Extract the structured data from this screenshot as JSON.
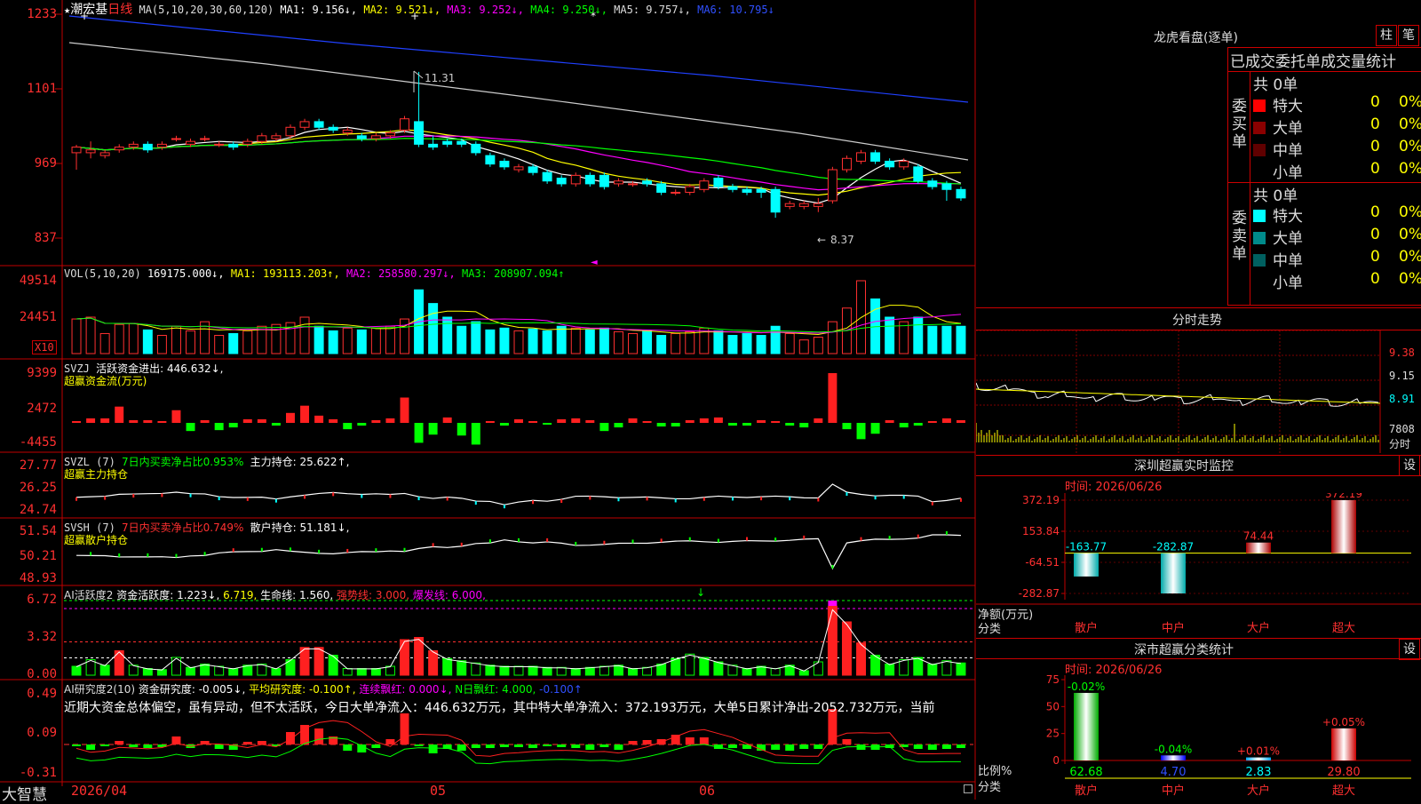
{
  "stock": {
    "name": "潮宏基",
    "period": "日线",
    "ma_header": {
      "label": "MA(5,10,20,30,60,120)",
      "ma1": "MA1: 9.156↓,",
      "ma2": "MA2: 9.521↓,",
      "ma3": "MA3: 9.252↓,",
      "ma4": "MA4: 9.250↓,",
      "ma5": "MA5: 9.757↓,",
      "ma6": "MA6: 10.795↓"
    },
    "price_axis": [
      "1233",
      "1101",
      "969",
      "837"
    ],
    "high_label": "11.31",
    "low_label": "8.37"
  },
  "vol_panel": {
    "label": "VOL(5,10,20)",
    "value": "169175.000↓,",
    "ma1": "MA1: 193113.203↑,",
    "ma2": "MA2: 258580.297↓,",
    "ma3": "MA3: 208907.094↑",
    "axis": [
      "49514",
      "24451"
    ],
    "unit": "X10"
  },
  "svzj_panel": {
    "label": "SVZJ",
    "line1": "活跃资金进出: 446.632↓,",
    "line2": "超赢资金流(万元)",
    "axis": [
      "9399",
      "2472",
      "-4455"
    ]
  },
  "svzl_panel": {
    "label": "SVZL (7)",
    "ratio": "7日内买卖净占比0.953%",
    "hold": "主力持仓: 25.622↑,",
    "line2": "超赢主力持仓",
    "axis": [
      "27.77",
      "26.25",
      "24.74"
    ]
  },
  "svsh_panel": {
    "label": "SVSH (7)",
    "ratio": "7日内买卖净占比0.749%",
    "hold": "散户持仓: 51.181↓,",
    "line2": "超赢散户持仓",
    "axis": [
      "51.54",
      "50.21",
      "48.93"
    ]
  },
  "ai_active_panel": {
    "label": "AI活跃度2",
    "degree": "资金活跃度: 1.223↓,",
    "v2": "6.719,",
    "life": "生命线: 1.560,",
    "strong": "强势线: 3.000,",
    "burst": "爆发线: 6.000,",
    "axis": [
      "6.72",
      "3.32",
      "0.00"
    ]
  },
  "ai_research_panel": {
    "label": "AI研究度2(10)",
    "research": "资金研究度: -0.005↓,",
    "avg": "平均研究度: -0.100↑,",
    "red": "连续飘红: 0.000↓,",
    "nred": "N日飘红: 4.000,",
    "nred2": "-0.100↑",
    "comment": "近期大资金总体偏空，虽有异动，但不太活跃，今日大单净流入：446.632万元，其中特大单净流入：372.193万元，大单5日累计净出-2052.732万元，当前",
    "axis": [
      "0.49",
      "0.09",
      "-0.31"
    ]
  },
  "bottom_bar": {
    "brand": "大智慧",
    "date": "2026/04",
    "month1": "05",
    "month2": "06"
  },
  "longhu": {
    "title": "龙虎看盘(逐单)",
    "btn_zhu": "柱",
    "btn_bi": "笔",
    "subtitle": "已成交委托单成交量统计",
    "buy_label": "委买单",
    "sell_label": "委卖单",
    "buy_total": "共 0单",
    "sell_total": "共 0单",
    "buy_rows": [
      {
        "name": "特大",
        "count": "0",
        "pct": "0%",
        "color": "#ff0000"
      },
      {
        "name": "大单",
        "count": "0",
        "pct": "0%",
        "color": "#8b0000"
      },
      {
        "name": "中单",
        "count": "0",
        "pct": "0%",
        "color": "#600000"
      },
      {
        "name": "小单",
        "count": "0",
        "pct": "0%",
        "color": "#000000"
      }
    ],
    "sell_rows": [
      {
        "name": "特大",
        "count": "0",
        "pct": "0%",
        "color": "#00ffff"
      },
      {
        "name": "大单",
        "count": "0",
        "pct": "0%",
        "color": "#008b8b"
      },
      {
        "name": "中单",
        "count": "0",
        "pct": "0%",
        "color": "#006060"
      },
      {
        "name": "小单",
        "count": "0",
        "pct": "0%",
        "color": "#000000"
      }
    ]
  },
  "intraday": {
    "title": "分时走势",
    "axis": [
      "9.38",
      "9.15",
      "8.91",
      "7808"
    ],
    "label": "分时"
  },
  "monitor": {
    "title": "深圳超赢实时监控",
    "btn": "设",
    "time": "时间: 2026/06/26",
    "axis": [
      "372.19",
      "153.84",
      "-64.51",
      "-282.87"
    ],
    "row_label1": "净额(万元)",
    "row_label2": "分类",
    "categories": [
      "散户",
      "中户",
      "大户",
      "超大"
    ],
    "values": [
      -163.77,
      -282.87,
      74.44,
      372.19
    ],
    "value_labels": [
      "-163.77",
      "-282.87",
      "74.44",
      "372.19"
    ]
  },
  "classify": {
    "title": "深市超赢分类统计",
    "btn": "设",
    "time": "时间: 2026/06/26",
    "axis": [
      "75",
      "50",
      "25",
      "0"
    ],
    "row_label1": "比例%",
    "row_label2": "分类",
    "categories": [
      "散户",
      "中户",
      "大户",
      "超大"
    ],
    "changes": [
      "-0.02%",
      "-0.04%",
      "+0.01%",
      "+0.05%"
    ],
    "values": [
      62.68,
      4.7,
      2.83,
      29.8
    ],
    "value_labels": [
      "62.68",
      "4.70",
      "2.83",
      "29.80"
    ]
  },
  "chart_data": {
    "type": "candlestick",
    "candles": [
      [
        9.88,
        9.98,
        9.58,
        10.02
      ],
      [
        9.88,
        9.93,
        9.78,
        10.08
      ],
      [
        9.83,
        9.88,
        9.78,
        9.93
      ],
      [
        9.93,
        9.98,
        9.88,
        10.03
      ],
      [
        9.98,
        10.03,
        9.93,
        10.08
      ],
      [
        10.03,
        9.93,
        9.88,
        10.08
      ],
      [
        9.98,
        10.03,
        9.93,
        10.08
      ],
      [
        10.13,
        10.13,
        10.08,
        10.18
      ],
      [
        10.03,
        10.08,
        9.98,
        10.13
      ],
      [
        10.13,
        10.13,
        10.08,
        10.18
      ],
      [
        10.03,
        10.03,
        9.98,
        10.08
      ],
      [
        10.03,
        9.98,
        9.93,
        10.08
      ],
      [
        10.03,
        10.08,
        9.98,
        10.13
      ],
      [
        10.08,
        10.18,
        10.03,
        10.23
      ],
      [
        10.13,
        10.18,
        10.08,
        10.23
      ],
      [
        10.18,
        10.33,
        10.13,
        10.38
      ],
      [
        10.33,
        10.43,
        10.28,
        10.48
      ],
      [
        10.43,
        10.33,
        10.28,
        10.48
      ],
      [
        10.33,
        10.28,
        10.23,
        10.38
      ],
      [
        10.23,
        10.28,
        10.18,
        10.33
      ],
      [
        10.18,
        10.13,
        10.08,
        10.23
      ],
      [
        10.13,
        10.18,
        10.08,
        10.23
      ],
      [
        10.18,
        10.23,
        10.13,
        10.28
      ],
      [
        10.28,
        10.48,
        10.23,
        10.53
      ],
      [
        10.43,
        10.03,
        9.98,
        11.31
      ],
      [
        10.03,
        9.98,
        9.93,
        10.18
      ],
      [
        10.08,
        10.03,
        9.98,
        10.13
      ],
      [
        10.08,
        10.03,
        9.98,
        10.13
      ],
      [
        10.03,
        9.88,
        9.83,
        10.08
      ],
      [
        9.83,
        9.68,
        9.63,
        9.88
      ],
      [
        9.73,
        9.63,
        9.58,
        9.78
      ],
      [
        9.58,
        9.63,
        9.53,
        9.68
      ],
      [
        9.63,
        9.53,
        9.48,
        9.68
      ],
      [
        9.53,
        9.38,
        9.33,
        9.58
      ],
      [
        9.43,
        9.33,
        9.28,
        9.48
      ],
      [
        9.33,
        9.48,
        9.28,
        9.53
      ],
      [
        9.48,
        9.33,
        9.28,
        9.53
      ],
      [
        9.48,
        9.28,
        9.23,
        9.53
      ],
      [
        9.33,
        9.38,
        9.28,
        9.43
      ],
      [
        9.33,
        9.33,
        9.28,
        9.38
      ],
      [
        9.38,
        9.33,
        9.28,
        9.43
      ],
      [
        9.33,
        9.18,
        9.13,
        9.38
      ],
      [
        9.18,
        9.18,
        9.13,
        9.23
      ],
      [
        9.18,
        9.28,
        9.13,
        9.33
      ],
      [
        9.23,
        9.38,
        9.18,
        9.43
      ],
      [
        9.43,
        9.28,
        9.23,
        9.48
      ],
      [
        9.28,
        9.23,
        9.18,
        9.33
      ],
      [
        9.23,
        9.18,
        9.13,
        9.28
      ],
      [
        9.23,
        9.18,
        9.08,
        9.28
      ],
      [
        9.23,
        8.83,
        8.73,
        9.28
      ],
      [
        8.93,
        8.98,
        8.88,
        9.03
      ],
      [
        8.93,
        8.98,
        8.88,
        9.03
      ],
      [
        8.93,
        8.98,
        8.83,
        9.08
      ],
      [
        9.03,
        9.58,
        8.98,
        9.63
      ],
      [
        9.58,
        9.78,
        9.53,
        9.83
      ],
      [
        9.73,
        9.88,
        9.68,
        9.93
      ],
      [
        9.88,
        9.73,
        9.68,
        9.93
      ],
      [
        9.73,
        9.63,
        9.58,
        9.78
      ],
      [
        9.63,
        9.73,
        9.58,
        9.78
      ],
      [
        9.63,
        9.38,
        9.33,
        9.68
      ],
      [
        9.38,
        9.28,
        9.23,
        9.43
      ],
      [
        9.33,
        9.23,
        9.03,
        9.38
      ],
      [
        9.23,
        9.08,
        9.03,
        9.28
      ]
    ],
    "volume": [
      38,
      40,
      22,
      32,
      33,
      26,
      20,
      30,
      25,
      35,
      20,
      22,
      25,
      30,
      32,
      34,
      40,
      30,
      25,
      28,
      26,
      28,
      30,
      38,
      70,
      55,
      40,
      30,
      35,
      26,
      28,
      25,
      27,
      25,
      30,
      28,
      26,
      28,
      24,
      22,
      25,
      20,
      22,
      24,
      28,
      25,
      20,
      22,
      20,
      30,
      22,
      15,
      18,
      35,
      50,
      80,
      60,
      40,
      35,
      40,
      30,
      30,
      30
    ],
    "svzj": [
      0.2,
      0.5,
      0.5,
      1.8,
      0.3,
      0.3,
      0.2,
      1.4,
      -0.9,
      0.3,
      -0.8,
      -0.5,
      0.4,
      0.4,
      -0.3,
      1.1,
      1.9,
      0.8,
      0.4,
      -0.7,
      -0.3,
      0.3,
      0.5,
      2.8,
      -2.2,
      -1.3,
      0.6,
      -1.4,
      -2.4,
      0.2,
      -0.3,
      0.4,
      0.2,
      -0.2,
      0.4,
      0.5,
      0.3,
      -0.9,
      -0.5,
      0.5,
      0.2,
      -0.4,
      -0.4,
      0.3,
      0.5,
      0.6,
      -0.3,
      -0.3,
      0.3,
      0.2,
      -0.3,
      -0.5,
      0.5,
      5.5,
      -0.7,
      -1.8,
      -1.2,
      0.3,
      -0.5,
      -0.3,
      0.2,
      0.5,
      0.3
    ],
    "ai_active": [
      0.8,
      1.4,
      0.9,
      2.2,
      0.9,
      0.6,
      0.5,
      1.6,
      0.7,
      1.0,
      0.8,
      0.6,
      0.9,
      1.0,
      0.6,
      1.4,
      2.5,
      2.5,
      1.8,
      0.6,
      0.6,
      0.6,
      0.8,
      3.2,
      3.4,
      2.2,
      1.5,
      1.3,
      1.1,
      0.9,
      0.8,
      0.8,
      0.8,
      0.7,
      0.7,
      0.6,
      0.7,
      0.8,
      0.9,
      0.6,
      0.7,
      1.0,
      1.5,
      1.9,
      1.6,
      1.2,
      0.9,
      0.6,
      0.8,
      0.6,
      0.9,
      0.4,
      1.2,
      6.2,
      4.8,
      2.9,
      1.8,
      1.0,
      1.4,
      1.6,
      1.0,
      1.3,
      1.1
    ],
    "ai_research": [
      -0.02,
      -0.06,
      -0.02,
      0.04,
      -0.03,
      -0.04,
      -0.03,
      0.09,
      -0.04,
      0.04,
      -0.05,
      -0.06,
      0.03,
      0.04,
      -0.02,
      0.14,
      0.22,
      0.18,
      0.09,
      -0.07,
      -0.09,
      -0.04,
      0.06,
      0.35,
      -0.02,
      -0.1,
      -0.05,
      -0.07,
      -0.04,
      -0.04,
      -0.03,
      -0.03,
      -0.04,
      -0.02,
      -0.03,
      -0.04,
      -0.06,
      -0.03,
      -0.06,
      0.04,
      0.05,
      0.06,
      0.11,
      0.08,
      0.08,
      -0.05,
      -0.04,
      -0.05,
      -0.07,
      -0.06,
      -0.07,
      -0.05,
      -0.05,
      0.4,
      0.06,
      -0.06,
      -0.06,
      -0.04,
      -0.03,
      -0.05,
      -0.06,
      -0.05,
      -0.04
    ]
  }
}
